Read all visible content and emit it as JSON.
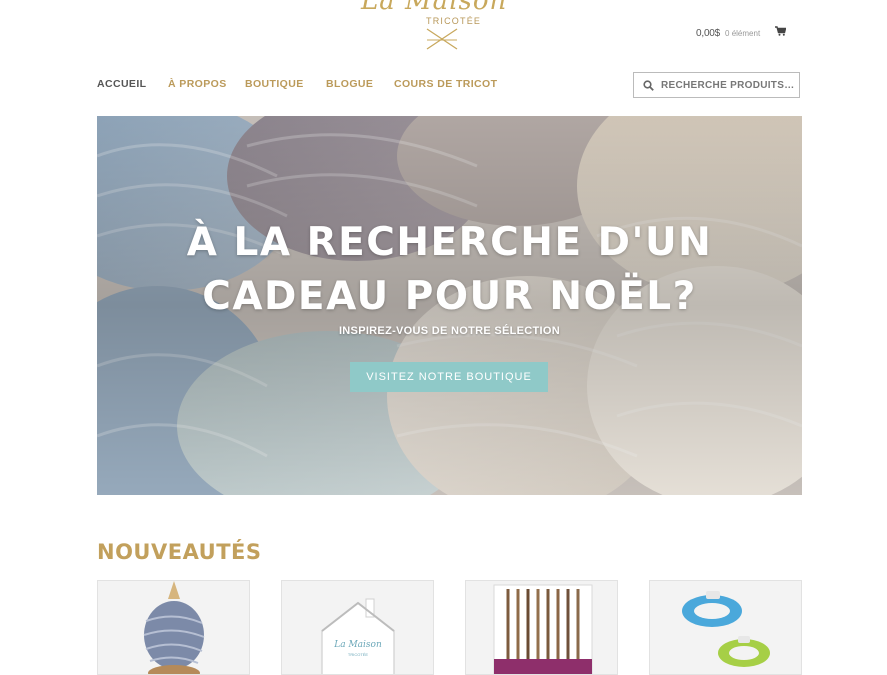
{
  "logo": {
    "script": "La Maison",
    "subtitle": "TRICOTÉE"
  },
  "cart": {
    "amount": "0,00$",
    "count": "0 élément",
    "icon": "cart-icon"
  },
  "nav": {
    "items": [
      {
        "label": "ACCUEIL",
        "active": true
      },
      {
        "label": "À PROPOS"
      },
      {
        "label": "BOUTIQUE"
      },
      {
        "label": "BLOGUE"
      },
      {
        "label": "COURS DE TRICOT"
      }
    ]
  },
  "search": {
    "placeholder": "RECHERCHE PRODUITS…",
    "value": "",
    "icon": "search-icon"
  },
  "hero": {
    "title_line1": "À LA RECHERCHE D'UN",
    "title_line2": "CADEAU POUR NOËL?",
    "subtitle": "INSPIREZ-VOUS DE NOTRE SÉLECTION",
    "button_label": "VISITEZ NOTRE BOUTIQUE"
  },
  "new_products": {
    "title": "NOUVEAUTÉS",
    "items": [
      {
        "image": "yarn-ball-on-winder"
      },
      {
        "image": "house-shaped-yarn-bowl"
      },
      {
        "image": "knitting-needles-set"
      },
      {
        "image": "pompom-makers"
      }
    ]
  },
  "colors": {
    "accent_gold": "#bb9a5a",
    "button_teal": "#8fc9c8",
    "nav_active": "#555555"
  }
}
